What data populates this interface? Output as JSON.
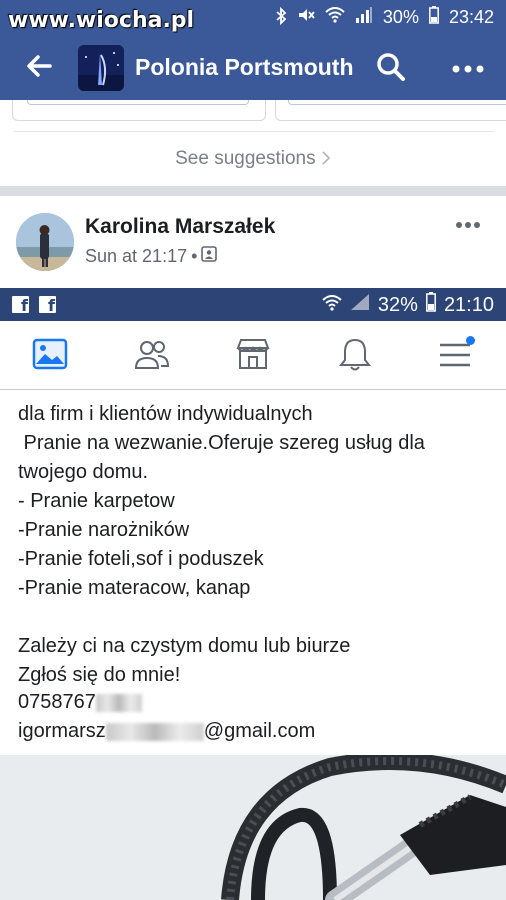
{
  "watermark": "www.wiocha.pl",
  "status_bar": {
    "battery": "30%",
    "time": "23:42"
  },
  "app_bar": {
    "title": "Polonia Portsmouth"
  },
  "suggestions": {
    "see_label": "See suggestions"
  },
  "post": {
    "author": "Karolina Marszałek",
    "time": "Sun at 21:17",
    "separator": "•",
    "body_lines": [
      "dla firm i klientów indywidualnych",
      " Pranie na wezwanie.Oferuje szereg usług dla",
      "twojego domu.",
      "- Pranie karpetow",
      "-Pranie narożników",
      "-Pranie foteli,sof i poduszek",
      "-Pranie materacow, kanap",
      "",
      "Zależy ci na czystym domu lub biurze",
      "Zgłoś się do mnie!"
    ],
    "phone_visible": "0758767",
    "email_prefix": "igormarsz",
    "email_suffix": "@gmail.com"
  },
  "inner_screenshot": {
    "status": {
      "battery": "32%",
      "time": "21:10"
    },
    "nav_icons": [
      "news-feed-icon",
      "friends-icon",
      "marketplace-icon",
      "notifications-icon",
      "menu-icon"
    ]
  },
  "colors": {
    "facebook_blue": "#3b5998",
    "inner_status": "#2c4476",
    "notification_dot": "#1877f2"
  }
}
